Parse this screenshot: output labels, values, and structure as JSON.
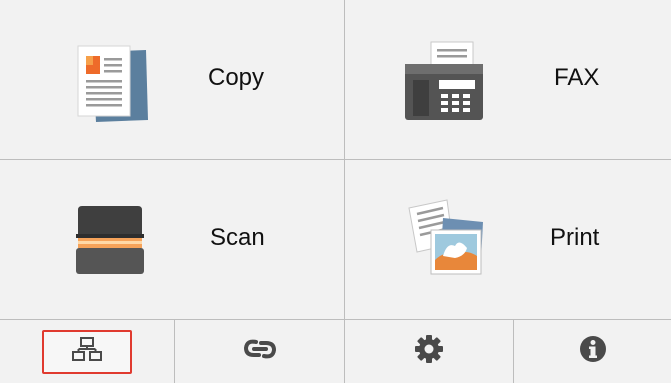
{
  "tiles": {
    "copy": {
      "label": "Copy",
      "icon": "copy-document-icon"
    },
    "fax": {
      "label": "FAX",
      "icon": "fax-machine-icon"
    },
    "scan": {
      "label": "Scan",
      "icon": "scanner-icon"
    },
    "print": {
      "label": "Print",
      "icon": "print-photo-icon"
    }
  },
  "bottom_bar": [
    {
      "icon": "network-icon",
      "selected": true
    },
    {
      "icon": "link-icon",
      "selected": false
    },
    {
      "icon": "gear-icon",
      "selected": false
    },
    {
      "icon": "info-icon",
      "selected": false
    }
  ],
  "colors": {
    "background": "#f2f2f2",
    "divider": "#bdbdbd",
    "selection_border": "#e03a2f",
    "icon_dark": "#4a4a4a"
  }
}
